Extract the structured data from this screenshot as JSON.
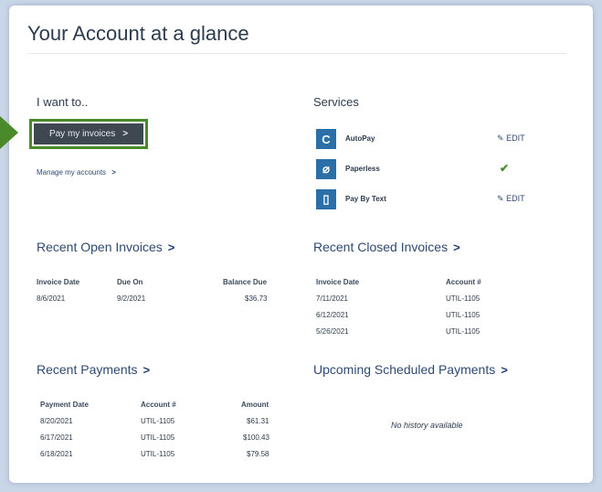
{
  "page_title": "Your Account at a glance",
  "i_want_to": {
    "heading": "I want to..",
    "pay_button_label": "Pay my invoices",
    "pay_button_arrow": ">",
    "manage_link_label": "Manage my accounts",
    "manage_link_arrow": ">"
  },
  "services": {
    "heading": "Services",
    "items": [
      {
        "label": "AutoPay",
        "icon": "refresh-icon",
        "icon_glyph": "C",
        "action": "EDIT",
        "status": ""
      },
      {
        "label": "Paperless",
        "icon": "leaf-icon",
        "icon_glyph": "⌀",
        "action": "",
        "status": "✔"
      },
      {
        "label": "Pay By Text",
        "icon": "phone-icon",
        "icon_glyph": "▯",
        "action": "EDIT",
        "status": ""
      }
    ],
    "edit_glyph": "✎"
  },
  "recent_open_invoices": {
    "title": "Recent Open Invoices",
    "chevron": ">",
    "columns": [
      "Invoice Date",
      "Due On",
      "Balance Due"
    ],
    "rows": [
      [
        "8/6/2021",
        "9/2/2021",
        "$36.73"
      ]
    ]
  },
  "recent_closed_invoices": {
    "title": "Recent Closed Invoices",
    "chevron": ">",
    "columns": [
      "Invoice Date",
      "Account #"
    ],
    "rows": [
      [
        "7/11/2021",
        "UTIL-1105"
      ],
      [
        "6/12/2021",
        "UTIL-1105"
      ],
      [
        "5/26/2021",
        "UTIL-1105"
      ]
    ]
  },
  "recent_payments": {
    "title": "Recent Payments",
    "chevron": ">",
    "columns": [
      "Payment Date",
      "Account #",
      "Amount"
    ],
    "rows": [
      [
        "8/20/2021",
        "UTIL-1105",
        "$61.31"
      ],
      [
        "6/17/2021",
        "UTIL-1105",
        "$100.43"
      ],
      [
        "6/18/2021",
        "UTIL-1105",
        "$79.58"
      ]
    ]
  },
  "upcoming_scheduled_payments": {
    "title": "Upcoming Scheduled Payments",
    "chevron": ">",
    "empty_message": "No history available"
  },
  "colors": {
    "accent_green": "#4a8a2a",
    "service_icon_blue": "#2a6fa8",
    "button_dark": "#3f4750",
    "link_blue": "#2e4a72"
  }
}
